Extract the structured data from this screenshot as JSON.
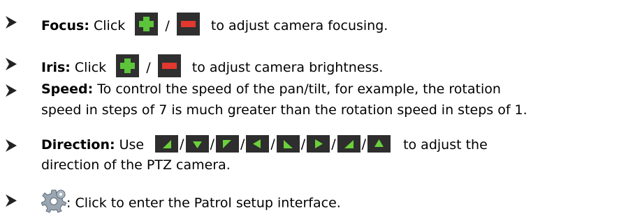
{
  "items": [
    {
      "label": "Focus:",
      "before": " Click",
      "slash": "/",
      "after": "to adjust camera focusing."
    },
    {
      "label": "Iris:",
      "before": " Click",
      "slash": "/",
      "after": "to adjust camera brightness."
    },
    {
      "label": "Speed:",
      "line1": " To control the speed of the pan/tilt, for example, the rotation",
      "line2": "speed in steps of 7 is much greater than the rotation speed in steps of 1."
    },
    {
      "label": "Direction:",
      "before": " Use",
      "after": "to adjust the",
      "line2": "direction of the PTZ camera."
    },
    {
      "after": ": Click to enter the Patrol setup interface."
    }
  ],
  "icons": {
    "plus": "plus-icon",
    "minus": "minus-icon",
    "gear": "gear-icon",
    "dirs": [
      "up-right-arrow-icon",
      "down-arrow-icon",
      "up-left-arrow-icon",
      "left-arrow-icon",
      "down-right-arrow-icon",
      "right-arrow-icon",
      "down-left-arrow-icon",
      "up-arrow-icon"
    ]
  },
  "colors": {
    "bullet": "#222222",
    "icon_green": "#5cc53a",
    "icon_red": "#e2382f",
    "icon_bg": "#2e2e2e",
    "icon_arrow": "#6ad13a"
  }
}
